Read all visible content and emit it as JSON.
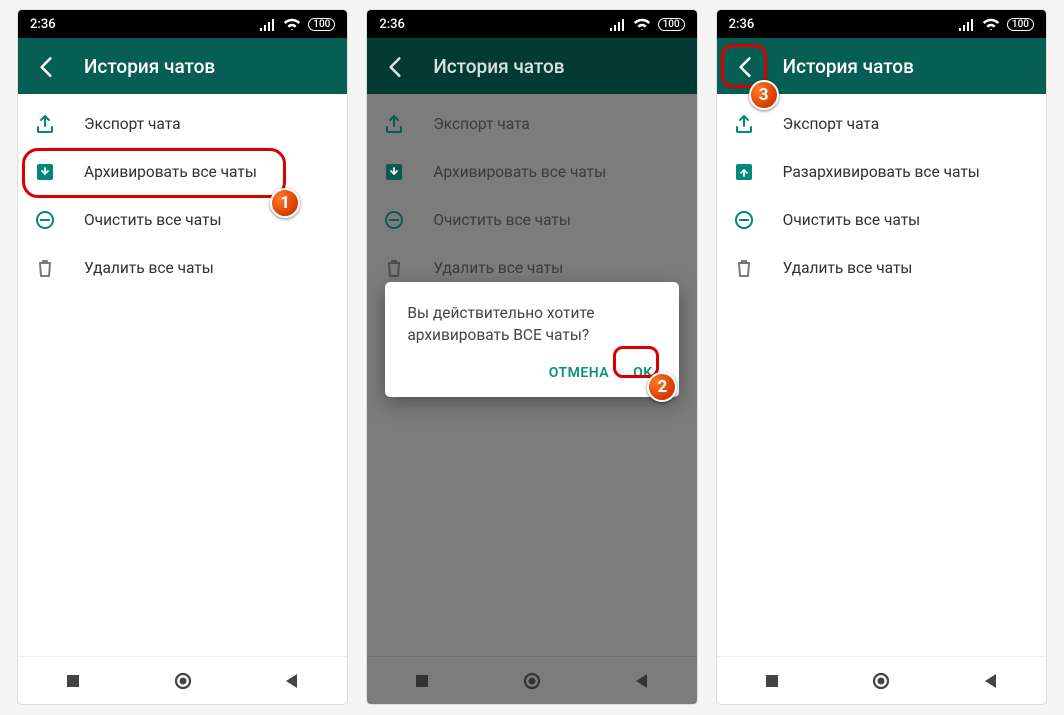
{
  "status": {
    "time": "2:36",
    "battery": "100"
  },
  "colors": {
    "primary": "#075E54",
    "accent": "#0a8f7f",
    "callout": "#d80000"
  },
  "screen1": {
    "title": "История чатов",
    "items": [
      {
        "icon": "export-icon",
        "label": "Экспорт чата"
      },
      {
        "icon": "archive-icon",
        "label": "Архивировать все чаты"
      },
      {
        "icon": "clear-icon",
        "label": "Очистить все чаты"
      },
      {
        "icon": "trash-icon",
        "label": "Удалить все чаты"
      }
    ],
    "callout_num": "1"
  },
  "screen2": {
    "title": "История чатов",
    "items": [
      {
        "icon": "export-icon",
        "label": "Экспорт чата"
      },
      {
        "icon": "archive-icon",
        "label": "Архивировать все чаты"
      },
      {
        "icon": "clear-icon",
        "label": "Очистить все чаты"
      },
      {
        "icon": "trash-icon",
        "label": "Удалить все чаты"
      }
    ],
    "dialog": {
      "message": "Вы действительно хотите архивировать ВСЕ чаты?",
      "cancel": "ОТМЕНА",
      "ok": "OK"
    },
    "callout_num": "2"
  },
  "screen3": {
    "title": "История чатов",
    "items": [
      {
        "icon": "export-icon",
        "label": "Экспорт чата"
      },
      {
        "icon": "unarchive-icon",
        "label": "Разархивировать все чаты"
      },
      {
        "icon": "clear-icon",
        "label": "Очистить все чаты"
      },
      {
        "icon": "trash-icon",
        "label": "Удалить все чаты"
      }
    ],
    "callout_num": "3"
  }
}
